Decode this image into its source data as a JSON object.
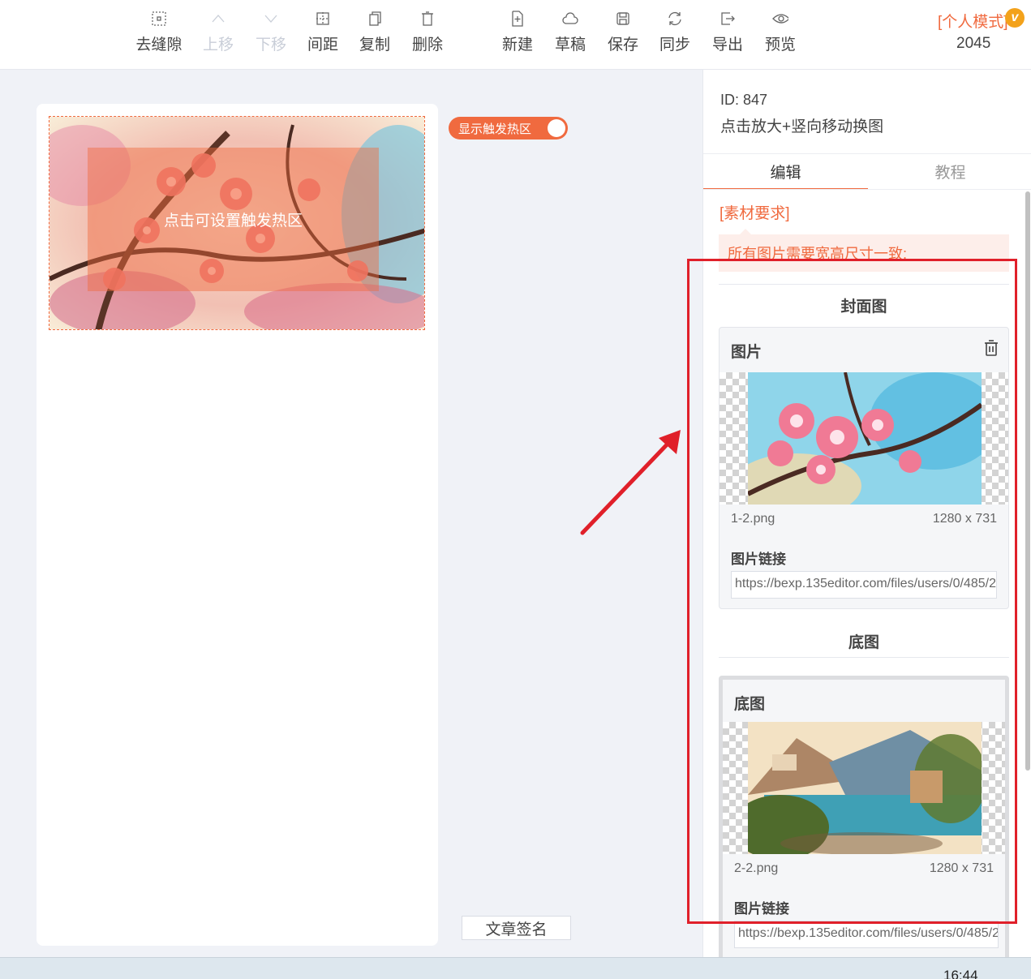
{
  "toolbar": {
    "remove_gaps": "去缝隙",
    "move_up": "上移",
    "move_down": "下移",
    "spacing": "间距",
    "copy": "复制",
    "delete": "删除",
    "new": "新建",
    "draft": "草稿",
    "save": "保存",
    "sync": "同步",
    "export": "导出",
    "preview": "预览",
    "mode": "[个人模式]",
    "vip_badge": "v",
    "count": "2045"
  },
  "canvas": {
    "hotspot_text": "点击可设置触发热区",
    "toggle_label": "显示触发热区",
    "toggle_on": true,
    "signature_button": "文章签名"
  },
  "panel": {
    "id_text": "ID: 847",
    "template_name": "点击放大+竖向移动换图",
    "tabs": [
      "编辑",
      "教程"
    ],
    "active_tab": 0,
    "requirements_title": "[素材要求]",
    "requirements_text": "所有图片需要宽高尺寸一致;",
    "cover_section": {
      "title": "封面图",
      "card_title": "图片",
      "filename": "1-2.png",
      "size": "1280 x 731",
      "link_label": "图片链接",
      "link_value": "https://bexp.135editor.com/files/users/0/485/2"
    },
    "base_section": {
      "title": "底图",
      "card_title": "底图",
      "filename": "2-2.png",
      "size": "1280 x 731",
      "link_label": "图片链接",
      "link_value": "https://bexp.135editor.com/files/users/0/485/2"
    }
  },
  "taskbar": {
    "clock": "16:44"
  },
  "colors": {
    "accent": "#f06a3f",
    "annotation_red": "#e0202a",
    "background": "#f0f2f7"
  }
}
